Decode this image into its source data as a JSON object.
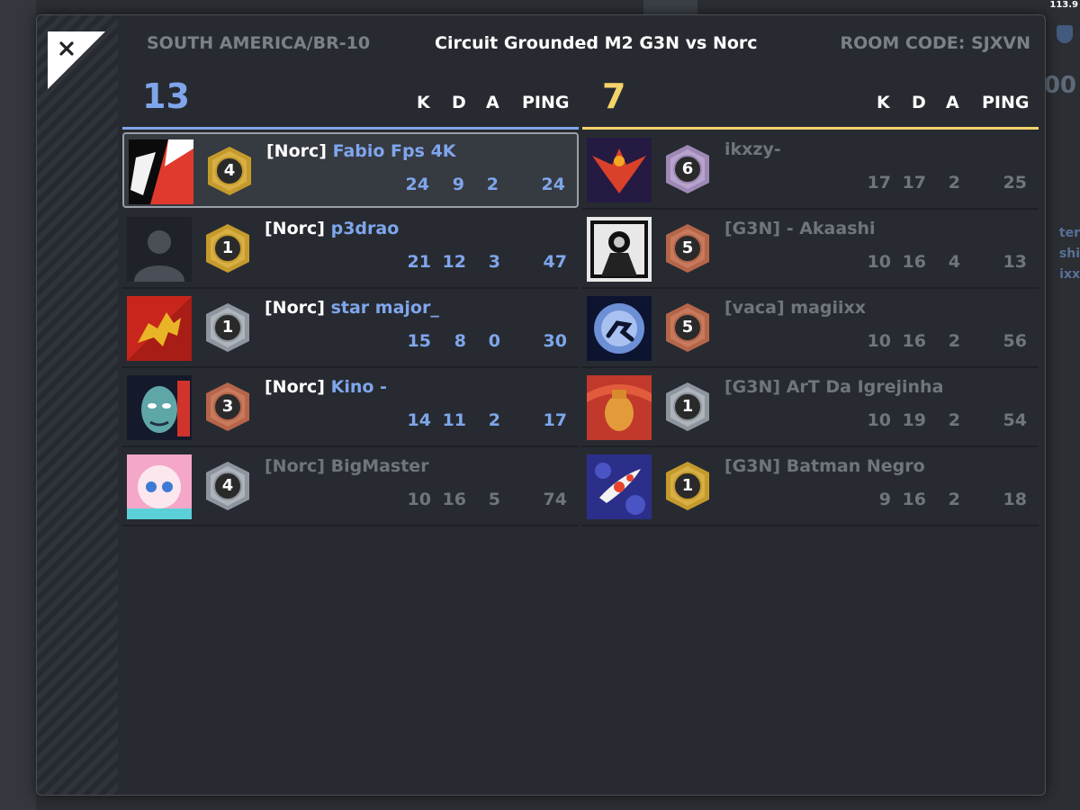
{
  "fps": "113.9",
  "background": {
    "list": [
      "ter",
      "shi",
      "ixx"
    ],
    "score": "00"
  },
  "header": {
    "region": "SOUTH AMERICA/BR-10",
    "match_title": "Circuit Grounded M2 G3N vs Norc",
    "room_code": "ROOM CODE: SJXVN"
  },
  "columns": {
    "k": "K",
    "d": "D",
    "a": "A",
    "ping": "PING"
  },
  "colors": {
    "blue_team": "#7fa6ec",
    "yellow_team": "#f5d36b",
    "dimmed": "#70757d",
    "panel": "#272b31"
  },
  "team_left": {
    "score": "13",
    "players": [
      {
        "tag": "[Norc]",
        "name": "Fabio Fps 4K",
        "level": "4",
        "badge": "gold",
        "k": "24",
        "d": "9",
        "a": "2",
        "ping": "24",
        "avatar": "red-white-abstract",
        "selected": true,
        "dimmed": false
      },
      {
        "tag": "[Norc]",
        "name": "p3drao",
        "level": "1",
        "badge": "gold",
        "k": "21",
        "d": "12",
        "a": "3",
        "ping": "47",
        "avatar": "default-silhouette",
        "selected": false,
        "dimmed": false
      },
      {
        "tag": "[Norc]",
        "name": "star major_",
        "level": "1",
        "badge": "silver",
        "k": "15",
        "d": "8",
        "a": "0",
        "ping": "30",
        "avatar": "gold-lion-on-red",
        "selected": false,
        "dimmed": false
      },
      {
        "tag": "[Norc]",
        "name": "Kino -",
        "level": "3",
        "badge": "bronze",
        "k": "14",
        "d": "11",
        "a": "2",
        "ping": "17",
        "avatar": "blue-face-portrait",
        "selected": false,
        "dimmed": false
      },
      {
        "tag": "[Norc]",
        "name": "BigMaster",
        "level": "4",
        "badge": "silver",
        "k": "10",
        "d": "16",
        "a": "5",
        "ping": "74",
        "avatar": "pink-anime-girl",
        "selected": false,
        "dimmed": true
      }
    ]
  },
  "team_right": {
    "score": "7",
    "players": [
      {
        "tag": "",
        "name": "ikxzy-",
        "level": "6",
        "badge": "purple",
        "k": "17",
        "d": "17",
        "a": "2",
        "ping": "25",
        "avatar": "phoenix-emblem",
        "selected": false,
        "dimmed": true
      },
      {
        "tag": "[G3N]",
        "name": "- Akaashi",
        "level": "5",
        "badge": "bronze",
        "k": "10",
        "d": "16",
        "a": "4",
        "ping": "13",
        "avatar": "monochrome-fighter",
        "selected": false,
        "dimmed": true
      },
      {
        "tag": "[vaca]",
        "name": "magiixx",
        "level": "5",
        "badge": "bronze",
        "k": "10",
        "d": "16",
        "a": "2",
        "ping": "56",
        "avatar": "jumper-moon",
        "selected": false,
        "dimmed": true
      },
      {
        "tag": "[G3N]",
        "name": "ArT Da Igrejinha",
        "level": "1",
        "badge": "silver",
        "k": "10",
        "d": "19",
        "a": "2",
        "ping": "54",
        "avatar": "snake-vase",
        "selected": false,
        "dimmed": true
      },
      {
        "tag": "[G3N]",
        "name": "Batman Negro",
        "level": "1",
        "badge": "gold",
        "k": "9",
        "d": "16",
        "a": "2",
        "ping": "18",
        "avatar": "koi-fish",
        "selected": false,
        "dimmed": true
      }
    ]
  }
}
